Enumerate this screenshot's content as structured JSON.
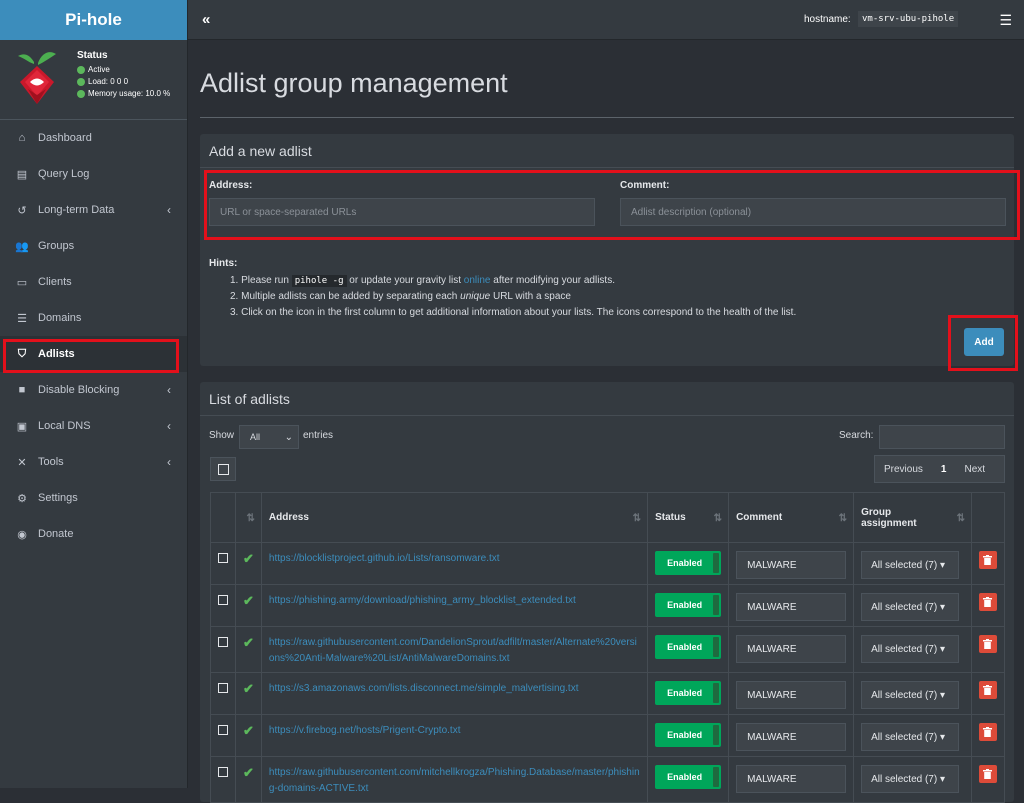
{
  "brand": "Pi-hole",
  "status": {
    "title": "Status",
    "active": "Active",
    "load": "Load:  0  0  0",
    "memory": "Memory usage:  10.0 %"
  },
  "sidebar": {
    "items": [
      {
        "label": "Dashboard",
        "icon": "home-icon",
        "chevron": false
      },
      {
        "label": "Query Log",
        "icon": "file-icon",
        "chevron": false
      },
      {
        "label": "Long-term Data",
        "icon": "history-icon",
        "chevron": true
      },
      {
        "label": "Groups",
        "icon": "users-icon",
        "chevron": false
      },
      {
        "label": "Clients",
        "icon": "laptop-icon",
        "chevron": false
      },
      {
        "label": "Domains",
        "icon": "list-icon",
        "chevron": false
      },
      {
        "label": "Adlists",
        "icon": "shield-icon",
        "chevron": false,
        "active": true
      },
      {
        "label": "Disable Blocking",
        "icon": "stop-icon",
        "chevron": true
      },
      {
        "label": "Local DNS",
        "icon": "address-book-icon",
        "chevron": true
      },
      {
        "label": "Tools",
        "icon": "tools-icon",
        "chevron": true
      },
      {
        "label": "Settings",
        "icon": "gear-icon",
        "chevron": false
      },
      {
        "label": "Donate",
        "icon": "donate-icon",
        "chevron": false
      }
    ]
  },
  "header": {
    "collapse": "«",
    "hostname_label": "hostname:",
    "hostname": "vm-srv-ubu-pihole"
  },
  "page": {
    "title": "Adlist group management"
  },
  "add_box": {
    "title": "Add a new adlist",
    "address_label": "Address:",
    "address_placeholder": "URL or space-separated URLs",
    "comment_label": "Comment:",
    "comment_placeholder": "Adlist description (optional)",
    "hints_title": "Hints:",
    "hint1_a": "1. Please run ",
    "hint1_code": "pihole -g",
    "hint1_b": " or update your gravity list ",
    "hint1_link": "online",
    "hint1_c": " after modifying your adlists.",
    "hint2_a": "2. Multiple adlists can be added by separating each ",
    "hint2_em": "unique",
    "hint2_b": " URL with a space",
    "hint3": "3. Click on the icon in the first column to get additional information about your lists. The icons correspond to the health of the list.",
    "add_label": "Add"
  },
  "list_box": {
    "title": "List of adlists",
    "show": "Show",
    "show_value": "All",
    "entries": "entries",
    "search": "Search:",
    "prev": "Previous",
    "page": "1",
    "next": "Next",
    "columns": {
      "address": "Address",
      "status": "Status",
      "comment": "Comment",
      "group": "Group assignment"
    },
    "rows": [
      {
        "address": "https://blocklistproject.github.io/Lists/ransomware.txt",
        "status": "Enabled",
        "comment": "MALWARE",
        "group": "All selected (7) ▾"
      },
      {
        "address": "https://phishing.army/download/phishing_army_blocklist_extended.txt",
        "status": "Enabled",
        "comment": "MALWARE",
        "group": "All selected (7) ▾"
      },
      {
        "address": "https://raw.githubusercontent.com/DandelionSprout/adfilt/master/Alternate%20versions%20Anti-Malware%20List/AntiMalwareDomains.txt",
        "status": "Enabled",
        "comment": "MALWARE",
        "group": "All selected (7) ▾"
      },
      {
        "address": "https://s3.amazonaws.com/lists.disconnect.me/simple_malvertising.txt",
        "status": "Enabled",
        "comment": "MALWARE",
        "group": "All selected (7) ▾"
      },
      {
        "address": "https://v.firebog.net/hosts/Prigent-Crypto.txt",
        "status": "Enabled",
        "comment": "MALWARE",
        "group": "All selected (7) ▾"
      },
      {
        "address": "https://raw.githubusercontent.com/mitchellkrogza/Phishing.Database/master/phishing-domains-ACTIVE.txt",
        "status": "Enabled",
        "comment": "MALWARE",
        "group": "All selected (7) ▾"
      }
    ]
  }
}
